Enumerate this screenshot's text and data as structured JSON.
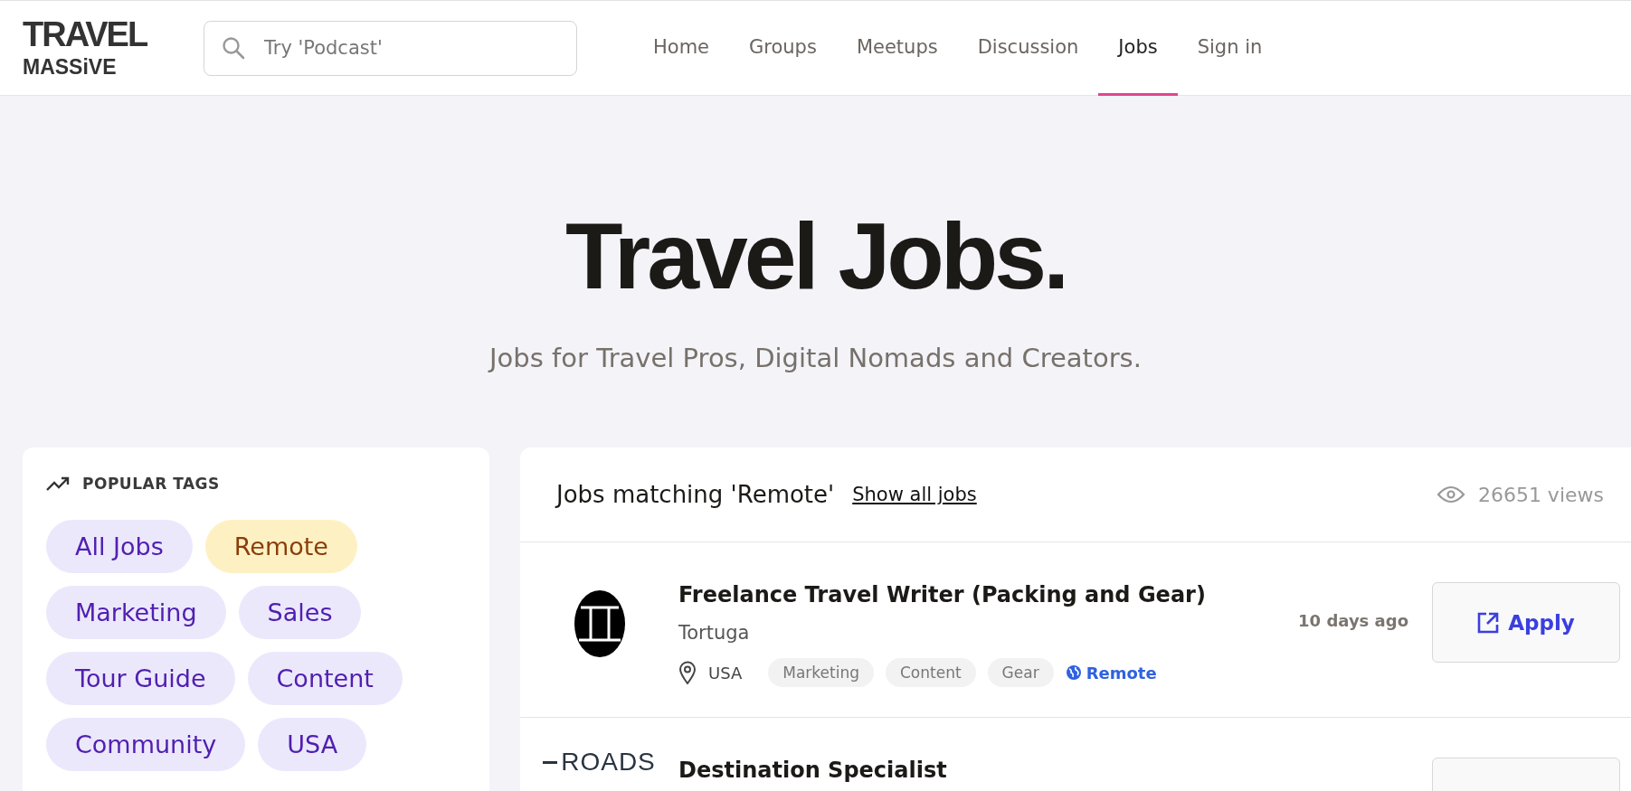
{
  "header": {
    "logo": {
      "line_1": "TRAVEL",
      "line_2": "MASSiVE"
    },
    "search": {
      "placeholder": "Try 'Podcast'"
    },
    "nav": [
      {
        "label": "Home",
        "selected": false
      },
      {
        "label": "Groups",
        "selected": false
      },
      {
        "label": "Meetups",
        "selected": false
      },
      {
        "label": "Discussion",
        "selected": false
      },
      {
        "label": "Jobs",
        "selected": true
      },
      {
        "label": "Sign in",
        "selected": false
      }
    ]
  },
  "hero": {
    "title": "Travel Jobs.",
    "subtitle": "Jobs for Travel Pros, Digital Nomads and Creators."
  },
  "popular_tags": {
    "title": "POPULAR TAGS",
    "tags": [
      {
        "label": "All Jobs",
        "selected": false
      },
      {
        "label": "Remote",
        "selected": true
      },
      {
        "label": "Marketing",
        "selected": false
      },
      {
        "label": "Sales",
        "selected": false
      },
      {
        "label": "Tour Guide",
        "selected": false
      },
      {
        "label": "Content",
        "selected": false
      },
      {
        "label": "Community",
        "selected": false
      },
      {
        "label": "USA",
        "selected": false
      }
    ]
  },
  "jobs": {
    "heading": "Jobs matching 'Remote'",
    "show_all": "Show all jobs",
    "views": "26651 views",
    "listings": [
      {
        "kind": "shell",
        "title": "Freelance Travel Writer (Packing and Gear)",
        "company": "Tortuga",
        "posted": "10 days ago",
        "location": "USA",
        "tags": [
          "Marketing",
          "Content",
          "Gear"
        ],
        "remote": "Remote",
        "apply": "Apply"
      },
      {
        "kind": "roads",
        "logo_text": "ROADS",
        "title": "Destination Specialist"
      }
    ]
  }
}
